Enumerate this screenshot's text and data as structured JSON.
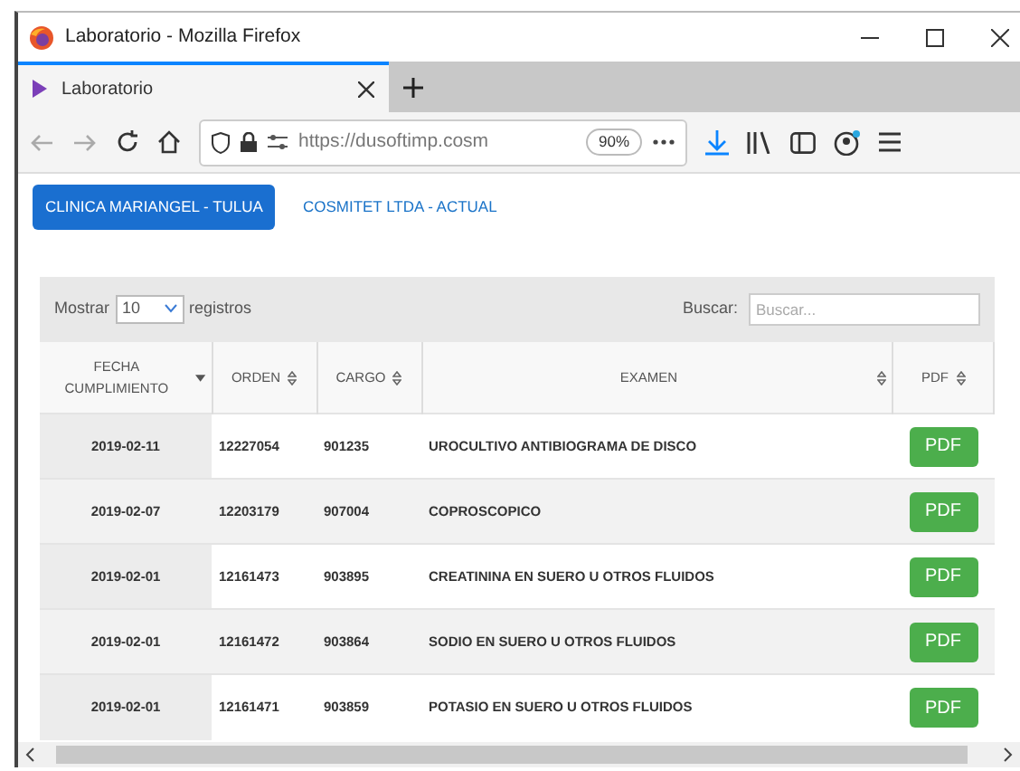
{
  "window": {
    "title": "Laboratorio - Mozilla Firefox"
  },
  "browser_tab": {
    "label": "Laboratorio"
  },
  "address_bar": {
    "url": "https://dusoftimp.cosm",
    "zoom": "90%"
  },
  "tabs": [
    {
      "label": "CLINICA MARIANGEL - TULUA",
      "selected": true
    },
    {
      "label": "COSMITET LTDA - ACTUAL",
      "selected": false
    }
  ],
  "table_controls": {
    "show_label": "Mostrar",
    "page_length": "10",
    "records_label": "registros",
    "search_label": "Buscar:",
    "search_placeholder": "Buscar..."
  },
  "columns": [
    {
      "label": "FECHA CUMPLIMIENTO",
      "sorted": true
    },
    {
      "label": "ORDEN",
      "sorted": false
    },
    {
      "label": "CARGO",
      "sorted": false
    },
    {
      "label": "EXAMEN",
      "sorted": false
    },
    {
      "label": "PDF",
      "sorted": false
    }
  ],
  "rows": [
    {
      "fecha": "2019-02-11",
      "orden": "12227054",
      "cargo": "901235",
      "examen": "UROCULTIVO ANTIBIOGRAMA DE DISCO",
      "pdf": "PDF"
    },
    {
      "fecha": "2019-02-07",
      "orden": "12203179",
      "cargo": "907004",
      "examen": "COPROSCOPICO",
      "pdf": "PDF"
    },
    {
      "fecha": "2019-02-01",
      "orden": "12161473",
      "cargo": "903895",
      "examen": "CREATININA EN SUERO U OTROS FLUIDOS",
      "pdf": "PDF"
    },
    {
      "fecha": "2019-02-01",
      "orden": "12161472",
      "cargo": "903864",
      "examen": "SODIO EN SUERO U OTROS FLUIDOS",
      "pdf": "PDF"
    },
    {
      "fecha": "2019-02-01",
      "orden": "12161471",
      "cargo": "903859",
      "examen": "POTASIO EN SUERO U OTROS FLUIDOS",
      "pdf": "PDF"
    }
  ]
}
